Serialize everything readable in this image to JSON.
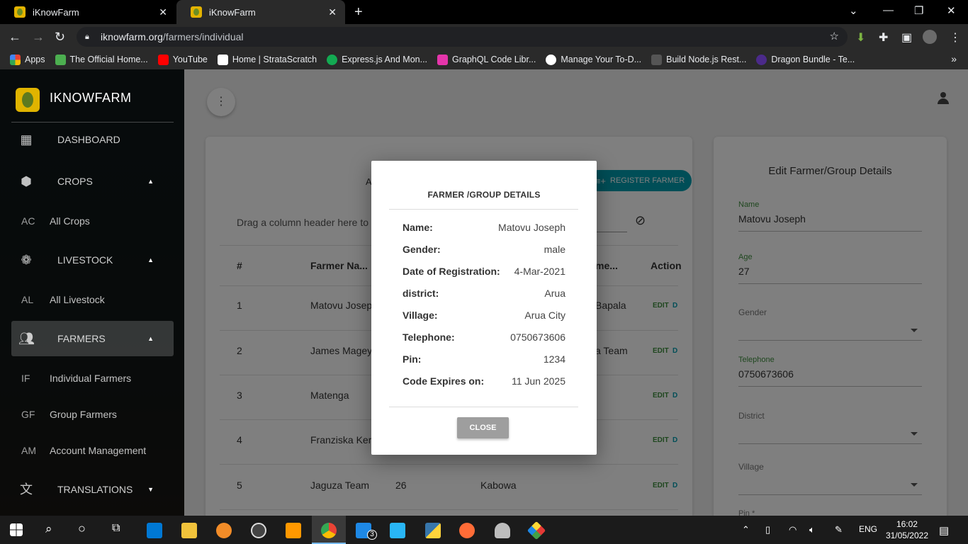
{
  "browser": {
    "tabs": [
      {
        "title": "iKnowFarm"
      },
      {
        "title": "iKnowFarm"
      }
    ],
    "url_host": "iknowfarm.org",
    "url_path": "/farmers/individual",
    "bookmarks": [
      {
        "label": "Apps",
        "color": "#e94235"
      },
      {
        "label": "The Official Home...",
        "color": "#4caf50"
      },
      {
        "label": "YouTube",
        "color": "#ff0000"
      },
      {
        "label": "Home | StrataScratch",
        "color": "#ffffff"
      },
      {
        "label": "Express.js And Mon...",
        "color": "#13aa52"
      },
      {
        "label": "GraphQL Code Libr...",
        "color": "#e535ab"
      },
      {
        "label": "Manage Your To-D...",
        "color": "#ffffff"
      },
      {
        "label": "Build Node.js Rest...",
        "color": "#888888"
      },
      {
        "label": "Dragon Bundle - Te...",
        "color": "#4b2a8a"
      }
    ]
  },
  "sidebar": {
    "brand": "IKNOWFARM",
    "items": [
      {
        "label": "DASHBOARD",
        "icon": "dashboard-icon"
      },
      {
        "label": "CROPS",
        "icon": "crops-icon"
      },
      {
        "abbr": "AC",
        "label": "All Crops"
      },
      {
        "label": "LIVESTOCK",
        "icon": "paw-icon"
      },
      {
        "abbr": "AL",
        "label": "All Livestock"
      },
      {
        "label": "FARMERS",
        "icon": "people-icon"
      },
      {
        "abbr": "IF",
        "label": "Individual Farmers"
      },
      {
        "abbr": "GF",
        "label": "Group Farmers"
      },
      {
        "abbr": "AM",
        "label": "Account Management"
      },
      {
        "label": "TRANSLATIONS",
        "icon": "translate-icon"
      }
    ]
  },
  "table_card": {
    "title_partial": "A",
    "register_button": "REGISTER FARMER",
    "drag_hint": "Drag a column header here to g",
    "headers": {
      "num": "#",
      "name": "Farmer Na...",
      "village": "me...",
      "action": "Action"
    },
    "rows": [
      {
        "num": "1",
        "name": "Matovu Josep",
        "age": "",
        "village": "Bapala",
        "edit": "EDIT",
        "delete": "D"
      },
      {
        "num": "2",
        "name": "James Magey",
        "age": "",
        "village": "a Team",
        "edit": "EDIT",
        "delete": "D"
      },
      {
        "num": "3",
        "name": "Matenga",
        "age": "",
        "village": "",
        "edit": "EDIT",
        "delete": "D"
      },
      {
        "num": "4",
        "name": "Franziska Ker",
        "age": "",
        "village": "",
        "edit": "EDIT",
        "delete": "D"
      },
      {
        "num": "5",
        "name": "Jaguza Team",
        "age": "26",
        "village": "Kabowa",
        "edit": "EDIT",
        "delete": "D"
      }
    ]
  },
  "edit_card": {
    "title": "Edit Farmer/Group Details",
    "fields": {
      "name_label": "Name",
      "name_value": "Matovu Joseph",
      "age_label": "Age",
      "age_value": "27",
      "gender_label": "Gender",
      "telephone_label": "Telephone",
      "telephone_value": "0750673606",
      "district_label": "District",
      "village_label": "Village",
      "pin_label": "Pin *"
    }
  },
  "modal": {
    "title": "FARMER /GROUP DETAILS",
    "rows": [
      {
        "key": "Name:",
        "value": "Matovu Joseph"
      },
      {
        "key": "Gender:",
        "value": "male"
      },
      {
        "key": "Date of Registration:",
        "value": "4-Mar-2021"
      },
      {
        "key": "district:",
        "value": "Arua"
      },
      {
        "key": "Village:",
        "value": "Arua City"
      },
      {
        "key": "Telephone:",
        "value": "0750673606"
      },
      {
        "key": "Pin:",
        "value": "1234"
      },
      {
        "key": "Code Expires on:",
        "value": "11 Jun 2025"
      }
    ],
    "close_label": "CLOSE"
  },
  "taskbar": {
    "lang": "ENG",
    "time": "16:02",
    "date": "31/05/2022",
    "badge": "3"
  },
  "colors": {
    "accent_teal": "#009daf",
    "edit_green": "#3f8f3f",
    "delete_teal": "#009daf"
  }
}
